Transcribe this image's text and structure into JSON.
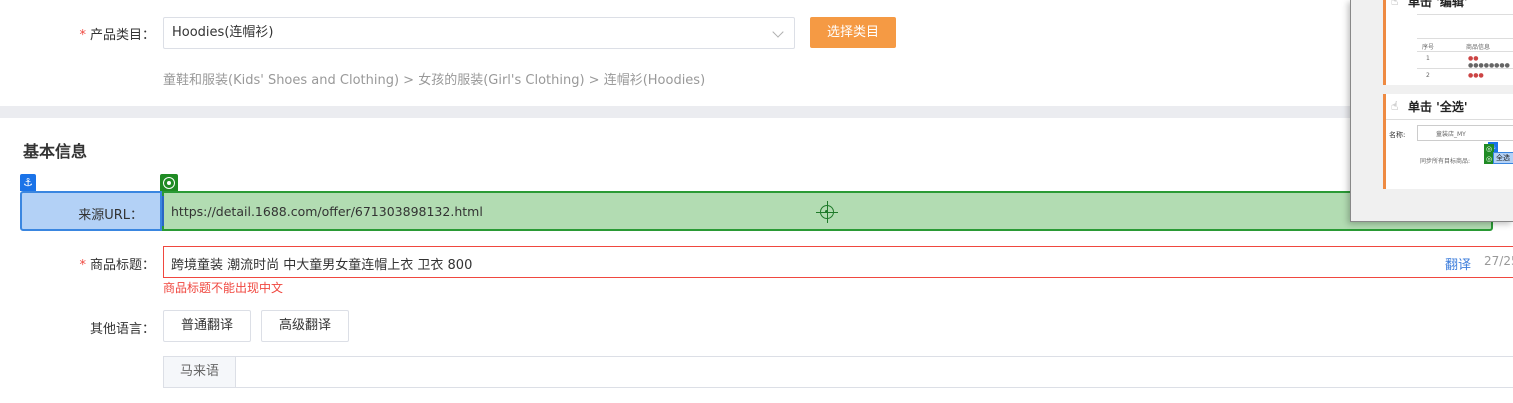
{
  "category": {
    "label": "产品类目：",
    "required_mark": "*",
    "selected_value": "Hoodies(连帽衫)",
    "select_button": "选择类目",
    "breadcrumb": "童鞋和服装(Kids' Shoes and Clothing) > 女孩的服装(Girl's Clothing) > 连帽衫(Hoodies)"
  },
  "basic_info": {
    "title": "基本信息",
    "source_url": {
      "label": "来源URL：",
      "value": "https://detail.1688.com/offer/671303898132.html",
      "anchor_glyph": "⚓"
    },
    "product_title": {
      "label": "商品标题：",
      "required_mark": "*",
      "value": "跨境童装 潮流时尚 中大童男女童连帽上衣 卫衣 800",
      "translate_link": "翻译",
      "char_count": "27/25",
      "error": "商品标题不能出现中文"
    },
    "other_languages": {
      "label": "其他语言：",
      "buttons": [
        "普通翻译",
        "高级翻译"
      ],
      "language_tag": "马来语"
    }
  },
  "float_panel": {
    "step1": {
      "title": "单击 '编辑'",
      "table_headers": [
        "序号",
        "商品信息"
      ],
      "rows": [
        "1",
        "2"
      ]
    },
    "step2": {
      "title": "单击 '全选'",
      "name_label": "名称:",
      "name_value": "童装店_MY",
      "hint": "同步所有目标商品:",
      "select_all": "全选",
      "badge_blue": "⚓",
      "badge_green": "◎"
    }
  },
  "colors": {
    "accent_orange": "#f59a44",
    "error_red": "#f0473f",
    "link_blue": "#3d7ddb",
    "highlight_blue": "#b3d1f6",
    "highlight_green": "#b2dcb2"
  }
}
